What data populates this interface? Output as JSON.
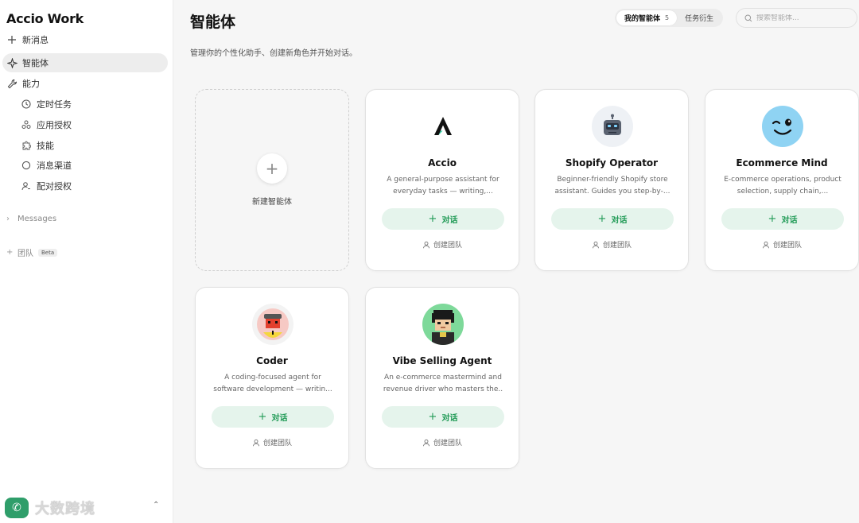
{
  "app": {
    "title": "Accio Work"
  },
  "sidebar": {
    "new_message": "新消息",
    "agents": "智能体",
    "capabilities": "能力",
    "sub_items": [
      "定时任务",
      "应用授权",
      "技能",
      "消息渠道",
      "配对授权"
    ],
    "messages_label": "Messages",
    "team_label": "团队",
    "beta_badge": "Beta",
    "watermark_text": "大数跨境"
  },
  "header": {
    "title": "智能体",
    "description": "管理你的个性化助手、创建新角色并开始对话。",
    "tabs": [
      {
        "label": "我的智能体",
        "count": "5"
      },
      {
        "label": "任务衍生"
      }
    ],
    "search_placeholder": "搜索智能体..."
  },
  "new_agent_label": "新建智能体",
  "chat_label": "对话",
  "team_link_label": "创建团队",
  "agents": [
    {
      "name": "Accio",
      "desc": "A general-purpose assistant for everyday tasks — writing,..."
    },
    {
      "name": "Shopify Operator",
      "desc": "Beginner-friendly Shopify store assistant. Guides you step-by-..."
    },
    {
      "name": "Ecommerce Mind",
      "desc": "E-commerce operations, product selection, supply chain,..."
    },
    {
      "name": "Coder",
      "desc": "A coding-focused agent for software development — writin..."
    },
    {
      "name": "Vibe Selling Agent",
      "desc": "An e-commerce mastermind and revenue driver who masters the.."
    }
  ],
  "colors": {
    "accent": "#1f9a55",
    "chat_bg": "#e5f4ec"
  }
}
